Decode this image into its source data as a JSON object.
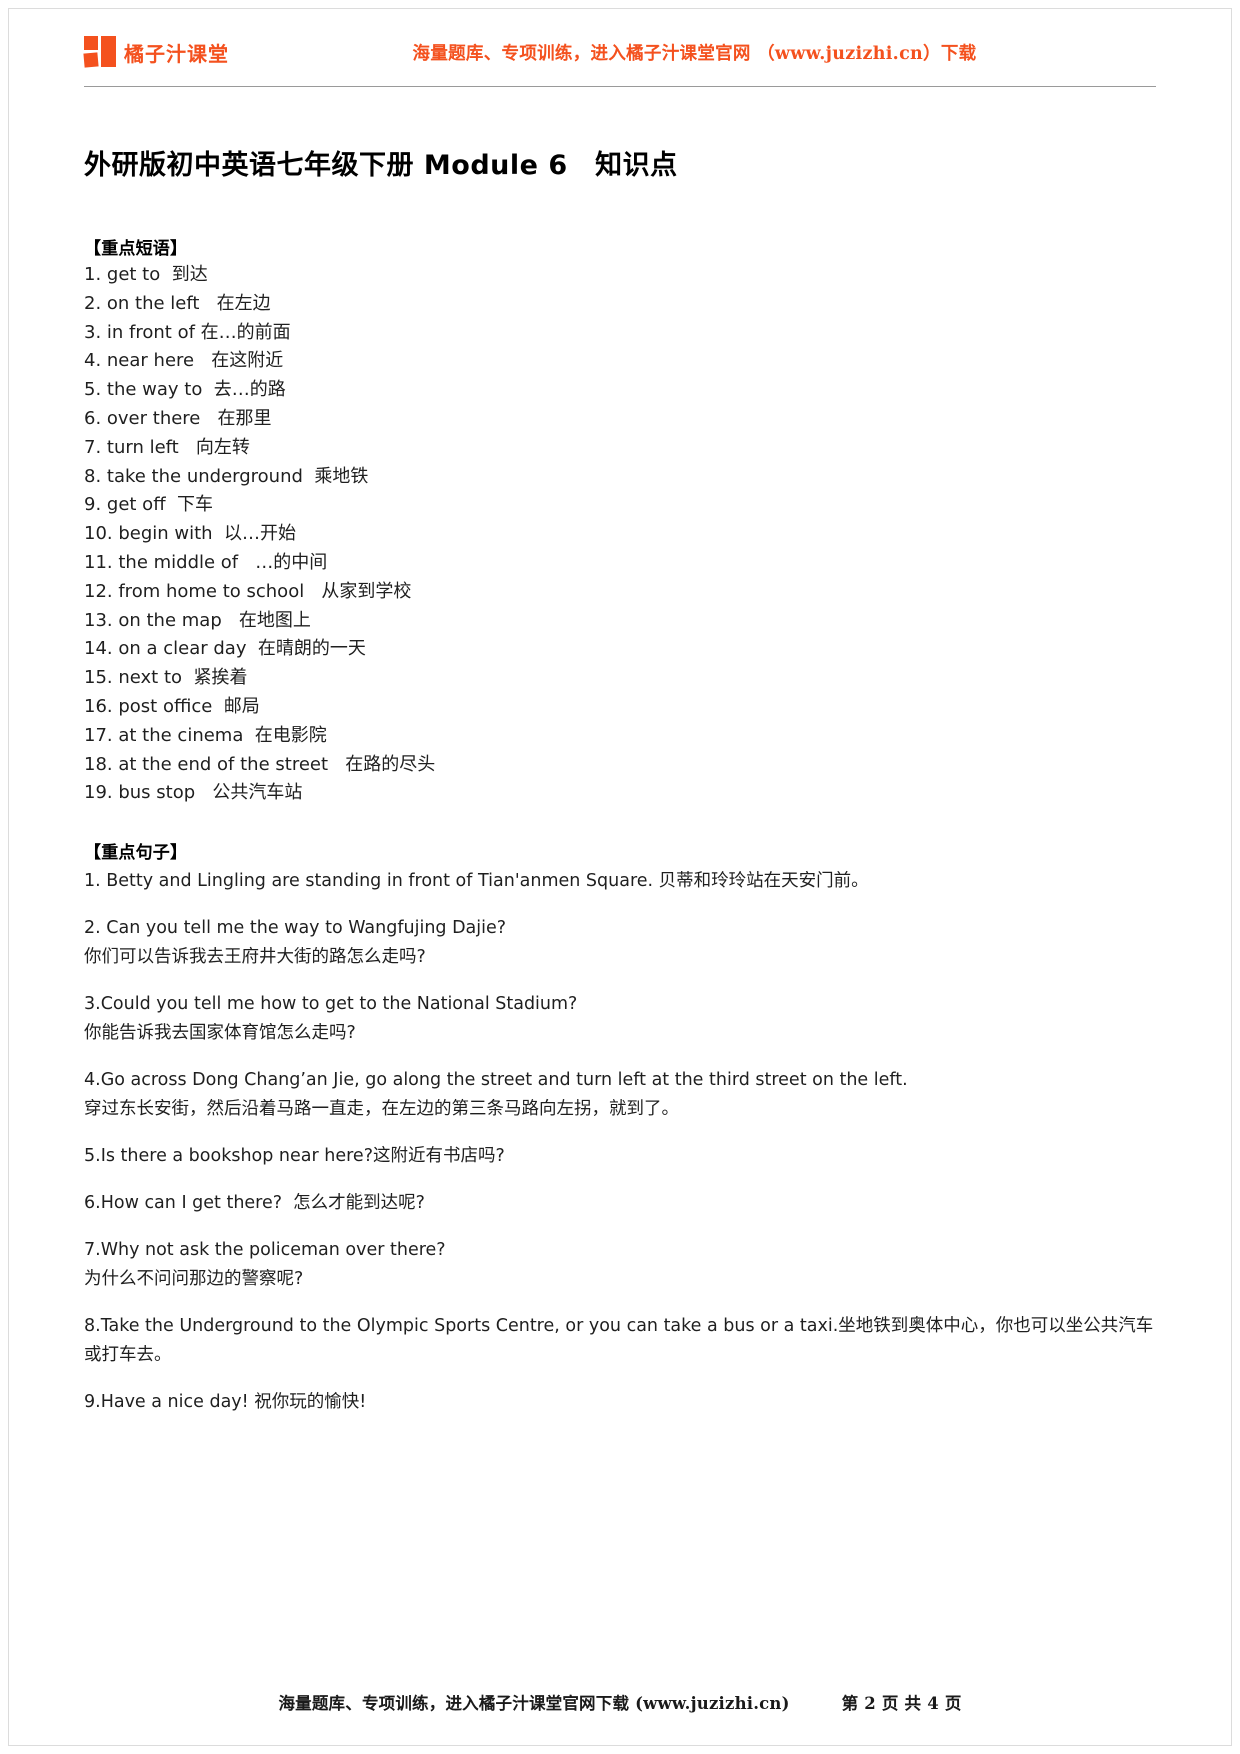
{
  "header": {
    "logo_text": "橘子汁课堂",
    "logo_icon": "orange-squares-logo",
    "promo": "海量题库、专项训练，进入橘子汁课堂官网 （www.juzizhi.cn）下载",
    "accent_color": "#f4511e"
  },
  "title": "外研版初中英语七年级下册 Module 6　知识点",
  "phrases_section": {
    "heading": "【重点短语】",
    "items": [
      "1. get to  到达",
      "2. on the left   在左边",
      "3. in front of 在…的前面",
      "4. near here   在这附近",
      "5. the way to  去…的路",
      "6. over there   在那里",
      "7. turn left   向左转",
      "8. take the underground  乘地铁",
      "9. get off  下车",
      "10. begin with  以…开始",
      "11. the middle of   …的中间",
      "12. from home to school   从家到学校",
      "13. on the map   在地图上",
      "14. on a clear day  在晴朗的一天",
      "15. next to  紧挨着",
      "16. post office  邮局",
      "17. at the cinema  在电影院",
      "18. at the end of the street   在路的尽头",
      "19. bus stop   公共汽车站"
    ]
  },
  "sentences_section": {
    "heading": "【重点句子】",
    "items": [
      {
        "lines": [
          "1. Betty and Lingling are standing in front of Tian'anmen Square. 贝蒂和玲玲站在天安门前。"
        ]
      },
      {
        "lines": [
          "2. Can you tell me the way to Wangfujing Dajie?",
          "你们可以告诉我去王府井大街的路怎么走吗?"
        ]
      },
      {
        "lines": [
          "3.Could you tell me how to get to the National Stadium?",
          "你能告诉我去国家体育馆怎么走吗?"
        ]
      },
      {
        "lines": [
          "4.Go across Dong Chang’an Jie, go along the street and turn left at the third street on the left.",
          "穿过东长安街，然后沿着马路一直走，在左边的第三条马路向左拐，就到了。"
        ]
      },
      {
        "lines": [
          "5.Is there a bookshop near here?这附近有书店吗?"
        ]
      },
      {
        "lines": [
          "6.How can I get there?  怎么才能到达呢?"
        ]
      },
      {
        "lines": [
          "7.Why not ask the policeman over there?",
          "为什么不问问那边的警察呢?"
        ]
      },
      {
        "lines": [
          "8.Take the Underground to the Olympic Sports Centre, or you can take a bus or a taxi.坐地铁到奥体中心，你也可以坐公共汽车或打车去。"
        ]
      },
      {
        "lines": [
          "9.Have a nice day! 祝你玩的愉快!"
        ]
      }
    ]
  },
  "footer": {
    "promo": "海量题库、专项训练，进入橘子汁课堂官网下载 (www.juzizhi.cn)",
    "pages": "第 2 页 共 4 页"
  }
}
